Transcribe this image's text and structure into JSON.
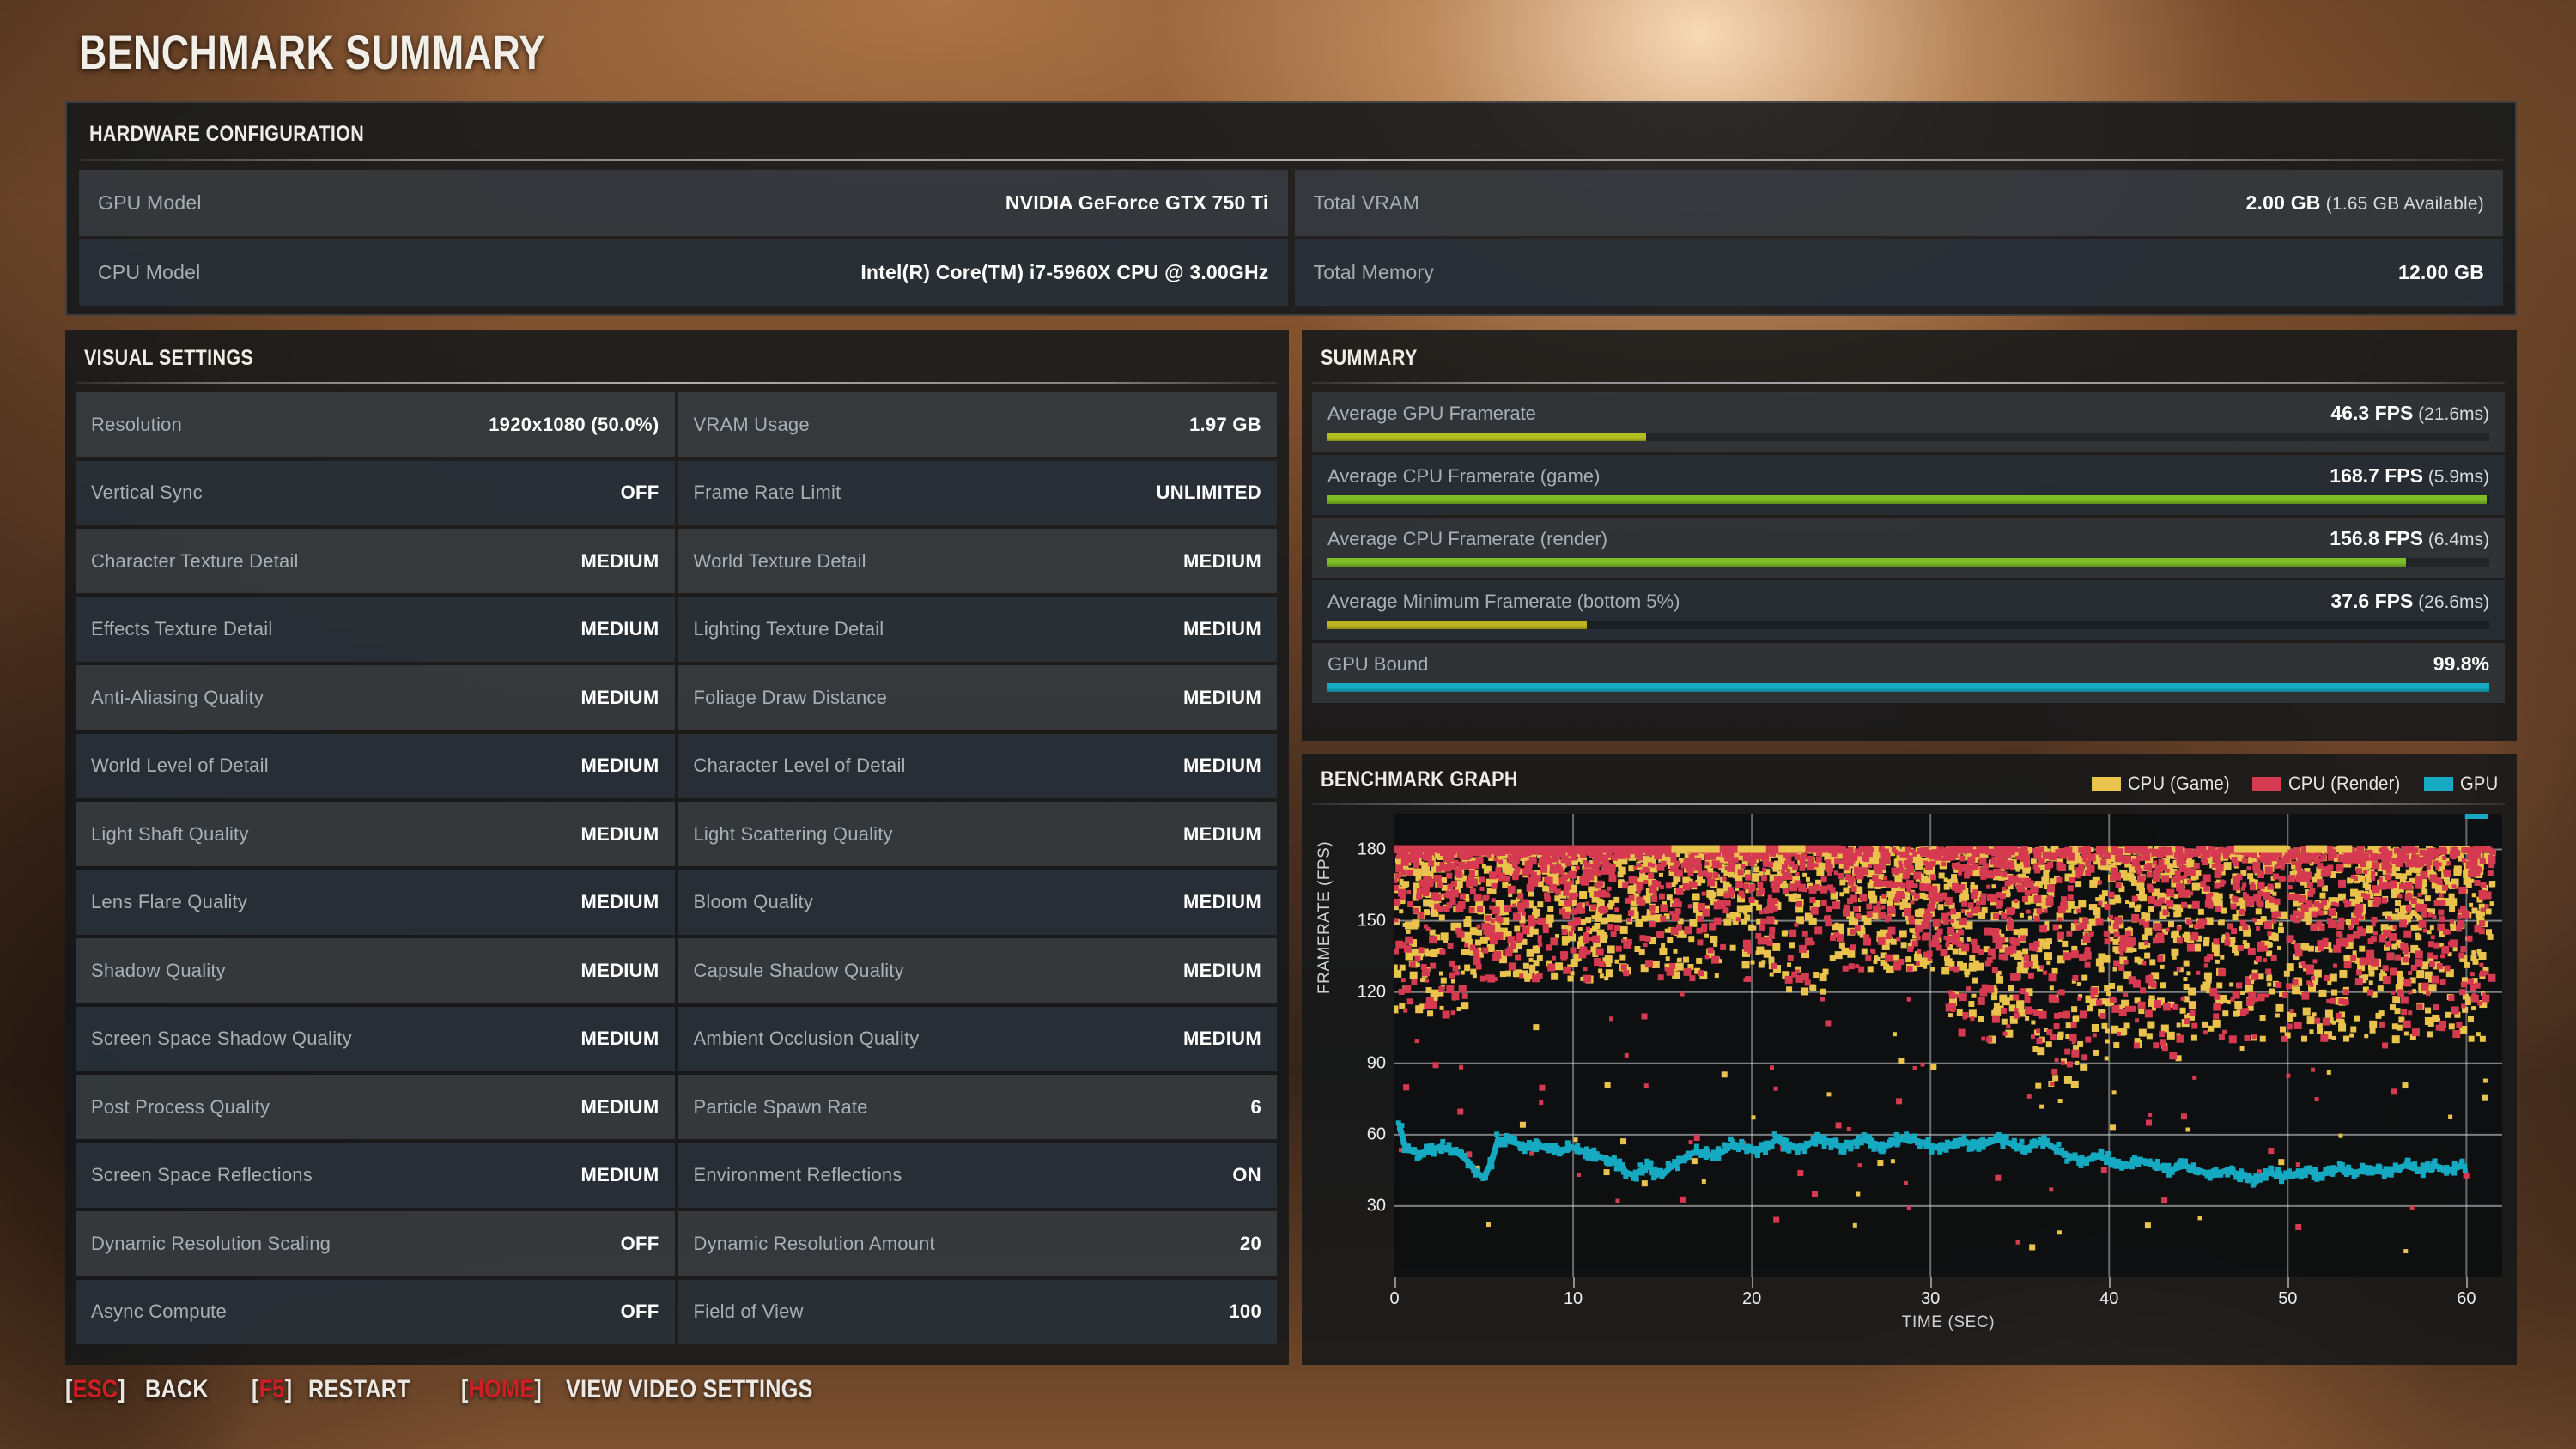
{
  "page": {
    "title": "BENCHMARK SUMMARY"
  },
  "hardware": {
    "header": "HARDWARE CONFIGURATION",
    "rows": [
      {
        "label": "GPU Model",
        "value": "NVIDIA GeForce GTX 750 Ti"
      },
      {
        "label": "Total VRAM",
        "value": "2.00 GB",
        "sub": "(1.65 GB Available)"
      },
      {
        "label": "CPU Model",
        "value": "Intel(R) Core(TM) i7-5960X CPU @ 3.00GHz"
      },
      {
        "label": "Total Memory",
        "value": "12.00 GB"
      }
    ]
  },
  "visual_settings": {
    "header": "VISUAL SETTINGS",
    "rows": [
      {
        "label": "Resolution",
        "value": "1920x1080 (50.0%)"
      },
      {
        "label": "VRAM Usage",
        "value": "1.97 GB"
      },
      {
        "label": "Vertical Sync",
        "value": "OFF"
      },
      {
        "label": "Frame Rate Limit",
        "value": "UNLIMITED"
      },
      {
        "label": "Character Texture Detail",
        "value": "MEDIUM"
      },
      {
        "label": "World Texture Detail",
        "value": "MEDIUM"
      },
      {
        "label": "Effects Texture Detail",
        "value": "MEDIUM"
      },
      {
        "label": "Lighting Texture Detail",
        "value": "MEDIUM"
      },
      {
        "label": "Anti-Aliasing Quality",
        "value": "MEDIUM"
      },
      {
        "label": "Foliage Draw Distance",
        "value": "MEDIUM"
      },
      {
        "label": "World Level of Detail",
        "value": "MEDIUM"
      },
      {
        "label": "Character Level of Detail",
        "value": "MEDIUM"
      },
      {
        "label": "Light Shaft Quality",
        "value": "MEDIUM"
      },
      {
        "label": "Light Scattering Quality",
        "value": "MEDIUM"
      },
      {
        "label": "Lens Flare Quality",
        "value": "MEDIUM"
      },
      {
        "label": "Bloom Quality",
        "value": "MEDIUM"
      },
      {
        "label": "Shadow Quality",
        "value": "MEDIUM"
      },
      {
        "label": "Capsule Shadow Quality",
        "value": "MEDIUM"
      },
      {
        "label": "Screen Space Shadow Quality",
        "value": "MEDIUM"
      },
      {
        "label": "Ambient Occlusion Quality",
        "value": "MEDIUM"
      },
      {
        "label": "Post Process Quality",
        "value": "MEDIUM"
      },
      {
        "label": "Particle Spawn Rate",
        "value": "6"
      },
      {
        "label": "Screen Space Reflections",
        "value": "MEDIUM"
      },
      {
        "label": "Environment Reflections",
        "value": "ON"
      },
      {
        "label": "Dynamic Resolution Scaling",
        "value": "OFF"
      },
      {
        "label": "Dynamic Resolution Amount",
        "value": "20"
      },
      {
        "label": "Async Compute",
        "value": "OFF"
      },
      {
        "label": "Field of View",
        "value": "100"
      }
    ]
  },
  "summary": {
    "header": "SUMMARY",
    "rows": [
      {
        "label": "Average GPU Framerate",
        "value": "46.3 FPS",
        "sub": "(21.6ms)",
        "bar_pct": 27.4,
        "color": "#b2bd1f"
      },
      {
        "label": "Average CPU Framerate (game)",
        "value": "168.7 FPS",
        "sub": "(5.9ms)",
        "bar_pct": 99.8,
        "color": "#7dbe25"
      },
      {
        "label": "Average CPU Framerate (render)",
        "value": "156.8 FPS",
        "sub": "(6.4ms)",
        "bar_pct": 92.8,
        "color": "#7dbe25"
      },
      {
        "label": "Average Minimum Framerate (bottom 5%)",
        "value": "37.6 FPS",
        "sub": "(26.6ms)",
        "bar_pct": 22.3,
        "color": "#bdb51f"
      },
      {
        "label": "GPU Bound",
        "value": "99.8%",
        "sub": "",
        "bar_pct": 100,
        "color": "#16aac2"
      }
    ]
  },
  "chart_data": {
    "type": "scatter",
    "title": "BENCHMARK GRAPH",
    "xlabel": "TIME (SEC)",
    "ylabel": "FRAMERATE (FPS)",
    "xlim": [
      0,
      62
    ],
    "ylim": [
      0,
      195
    ],
    "xticks": [
      0,
      10,
      20,
      30,
      40,
      50,
      60
    ],
    "yticks": [
      30,
      60,
      90,
      120,
      150,
      180
    ],
    "grid": true,
    "legend_position": "top-right",
    "legend": [
      {
        "name": "CPU (Game)",
        "color": "#e9c34c"
      },
      {
        "name": "CPU (Render)",
        "color": "#d63a50"
      },
      {
        "name": "GPU",
        "color": "#16aac2"
      }
    ],
    "series": [
      {
        "name": "GPU",
        "color": "#16aac2",
        "render": "line",
        "x": [
          0.3,
          0.6,
          1.0,
          1.4,
          1.8,
          2.2,
          2.6,
          3.0,
          3.4,
          3.8,
          4.2,
          4.6,
          5.0,
          5.4,
          5.8,
          6.2,
          6.6,
          7.0,
          7.4,
          7.8,
          8.2,
          8.6,
          9.0,
          9.4,
          9.8,
          10.2,
          10.6,
          11.0,
          11.4,
          11.8,
          12.2,
          12.6,
          13.0,
          13.4,
          13.8,
          14.2,
          14.6,
          15.0,
          15.4,
          15.8,
          16.2,
          16.6,
          17.0,
          17.4,
          17.8,
          18.2,
          18.6,
          19.0,
          19.4,
          19.8,
          20.2,
          20.6,
          21.0,
          21.4,
          21.8,
          22.2,
          22.6,
          23.0,
          23.4,
          23.8,
          24.2,
          24.6,
          25.0,
          25.4,
          25.8,
          26.2,
          26.6,
          27.0,
          27.4,
          27.8,
          28.2,
          28.6,
          29.0,
          29.4,
          29.8,
          30.2,
          30.6,
          31.0,
          31.4,
          31.8,
          32.2,
          32.6,
          33.0,
          33.4,
          33.8,
          34.2,
          34.6,
          35.0,
          35.4,
          35.8,
          36.2,
          36.6,
          37.0,
          37.4,
          37.8,
          38.2,
          38.6,
          39.0,
          39.4,
          39.8,
          40.2,
          40.6,
          41.0,
          41.4,
          41.8,
          42.2,
          42.6,
          43.0,
          43.4,
          43.8,
          44.2,
          44.6,
          45.0,
          45.4,
          45.8,
          46.2,
          46.6,
          47.0,
          47.4,
          47.8,
          48.2,
          48.6,
          49.0,
          49.4,
          49.8,
          50.2,
          50.6,
          51.0,
          51.4,
          51.8,
          52.2,
          52.6,
          53.0,
          53.4,
          53.8,
          54.2,
          54.6,
          55.0,
          55.4,
          55.8,
          56.2,
          56.6,
          57.0,
          57.4,
          57.8,
          58.2,
          58.6,
          59.0,
          59.4,
          59.8,
          60.2,
          60.6,
          61.0
        ],
        "y": [
          63,
          55,
          53,
          52,
          53,
          54,
          55,
          54,
          53,
          51,
          48,
          44,
          42,
          48,
          58,
          58,
          57,
          56,
          55,
          56,
          55,
          54,
          54,
          53,
          55,
          54,
          53,
          52,
          51,
          50,
          49,
          47,
          44,
          43,
          45,
          47,
          44,
          43,
          46,
          48,
          50,
          52,
          53,
          52,
          51,
          52,
          54,
          56,
          55,
          54,
          53,
          54,
          56,
          58,
          56,
          55,
          54,
          55,
          57,
          58,
          57,
          56,
          55,
          56,
          57,
          58,
          57,
          56,
          55,
          56,
          58,
          59,
          58,
          57,
          56,
          55,
          54,
          55,
          57,
          58,
          56,
          55,
          56,
          57,
          58,
          57,
          56,
          55,
          54,
          56,
          57,
          56,
          54,
          52,
          51,
          50,
          49,
          50,
          51,
          50,
          49,
          48,
          47,
          48,
          49,
          48,
          47,
          46,
          45,
          46,
          47,
          46,
          45,
          44,
          43,
          44,
          45,
          44,
          43,
          42,
          41,
          43,
          44,
          43,
          42,
          43,
          44,
          45,
          44,
          43,
          44,
          45,
          46,
          45,
          44,
          45,
          46,
          45,
          44,
          45,
          46,
          47,
          46,
          45,
          46,
          47,
          46,
          45,
          46,
          47
        ]
      },
      {
        "name": "CPU (Render)",
        "color": "#d63a50",
        "render": "scatter",
        "note": "Dense scatter 120-180 FPS for t=0-25 and t=37-60, capped line at 180 FPS for t=0-25"
      },
      {
        "name": "CPU (Game)",
        "color": "#e9c34c",
        "render": "scatter",
        "note": "Dense scatter 130-180 FPS across most of run, capped segments at 180 FPS"
      }
    ]
  },
  "footer": {
    "keys": [
      {
        "key": "ESC",
        "action": "BACK"
      },
      {
        "key": "F5",
        "action": "RESTART"
      },
      {
        "key": "HOME",
        "action": "VIEW VIDEO SETTINGS"
      }
    ]
  }
}
